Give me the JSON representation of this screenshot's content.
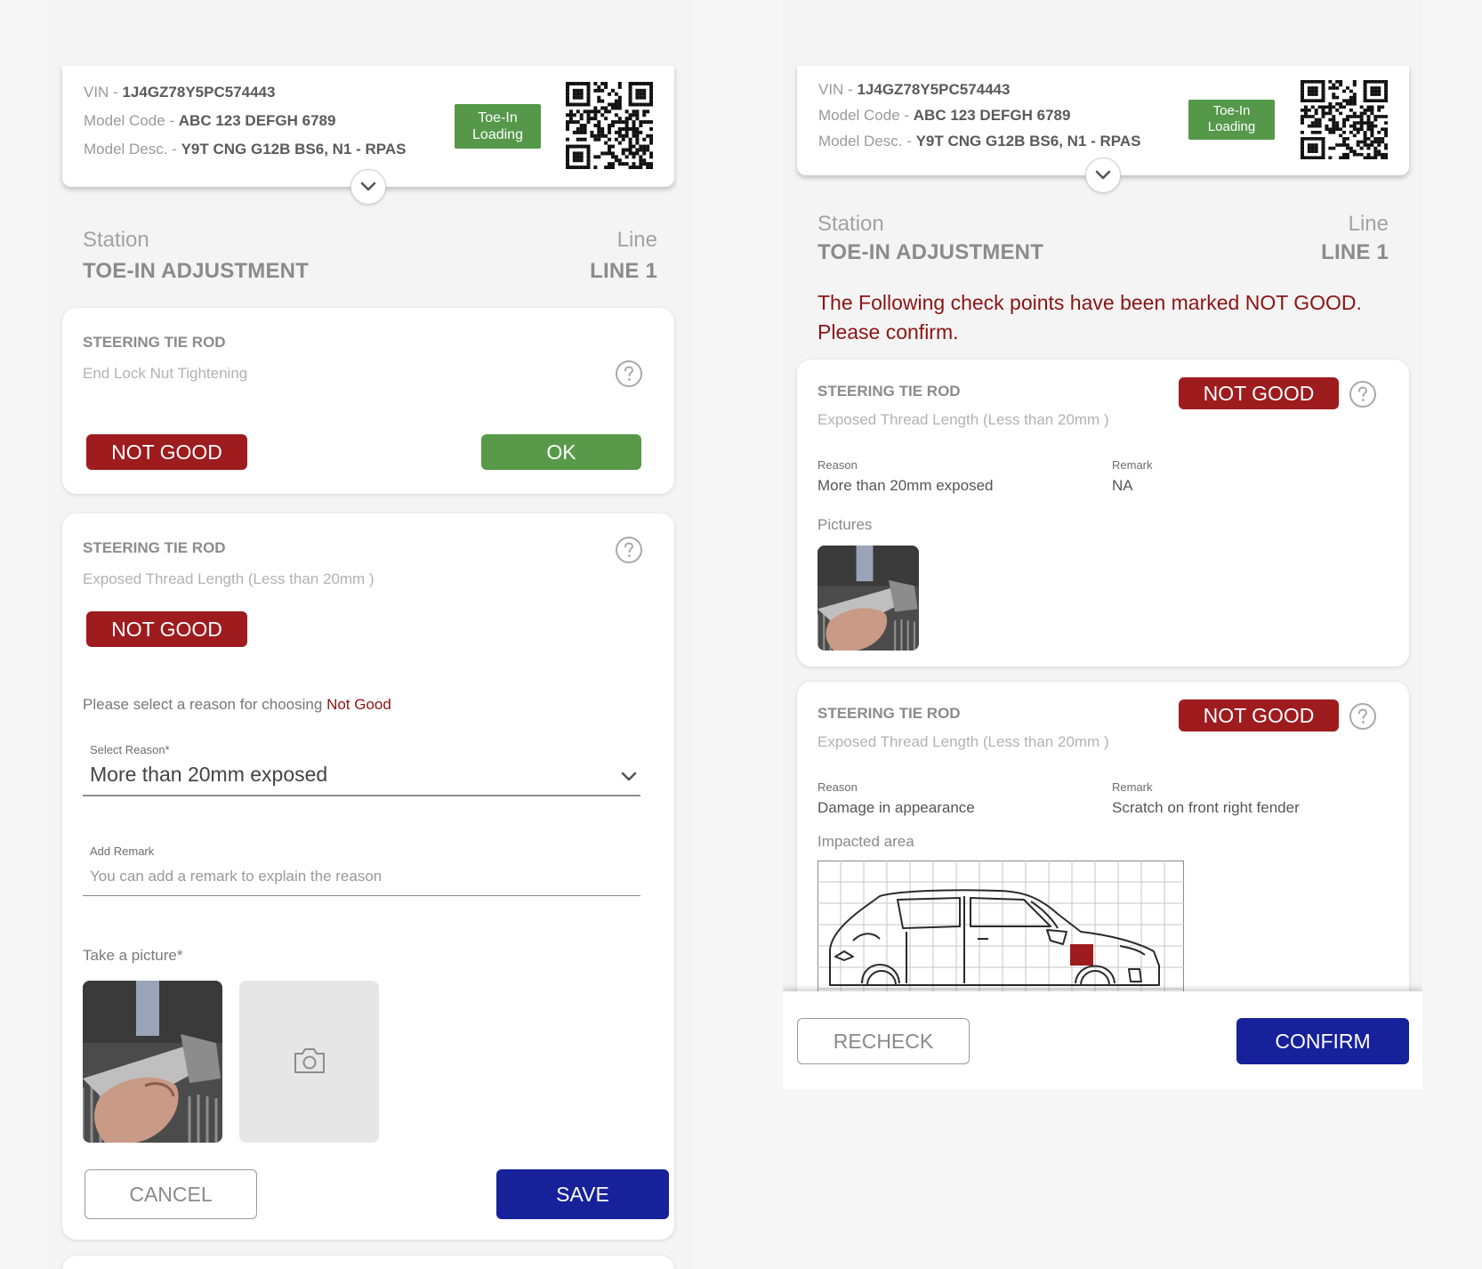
{
  "vehicle": {
    "vin_label": "VIN - ",
    "vin": "1J4GZ78Y5PC574443",
    "model_code_label": "Model Code - ",
    "model_code": "ABC 123 DEFGH 6789",
    "model_desc_label": "Model Desc. - ",
    "model_desc": "Y9T CNG G12B BS6, N1 - RPAS",
    "badge_line1": "Toe-In",
    "badge_line2": "Loading"
  },
  "station": {
    "station_label": "Station",
    "station_value": "TOE-IN ADJUSTMENT",
    "line_label": "Line",
    "line_value": "LINE 1"
  },
  "left": {
    "check1": {
      "title": "STEERING TIE ROD",
      "desc": "End Lock Nut Tightening",
      "not_good_label": "NOT GOOD",
      "ok_label": "OK"
    },
    "check2": {
      "title": "STEERING TIE ROD",
      "desc": "Exposed Thread Length (Less than 20mm )",
      "not_good_label": "NOT GOOD",
      "reason_prompt": "Please select a reason for choosing ",
      "reason_prompt_emph": "Not Good",
      "select_label": "Select Reason*",
      "select_value": "More than 20mm exposed",
      "remark_label": "Add Remark",
      "remark_placeholder": "You can add a remark to explain the reason",
      "picture_label": "Take a picture*",
      "cancel_label": "CANCEL",
      "save_label": "SAVE"
    }
  },
  "right": {
    "warning_line1": "The Following check points have been marked NOT GOOD.",
    "warning_line2": "Please confirm.",
    "items": [
      {
        "title": "STEERING TIE ROD",
        "desc": "Exposed Thread Length (Less than 20mm )",
        "status": "NOT GOOD",
        "reason_label": "Reason",
        "reason": "More than 20mm exposed",
        "remark_label": "Remark",
        "remark": "NA",
        "media_label": "Pictures"
      },
      {
        "title": "STEERING TIE ROD",
        "desc": "Exposed Thread Length (Less than 20mm )",
        "status": "NOT GOOD",
        "reason_label": "Reason",
        "reason": "Damage in appearance",
        "remark_label": "Remark",
        "remark": "Scratch on front right fender",
        "media_label": "Impacted area"
      }
    ],
    "recheck_label": "RECHECK",
    "confirm_label": "CONFIRM"
  },
  "colors": {
    "not_good": "#9e1b1e",
    "ok": "#589a4a",
    "primary": "#16219a",
    "badge": "#55984a",
    "warning_text": "#8c1313"
  },
  "icons": [
    "chevron-down-icon",
    "help-icon",
    "camera-icon",
    "qr-code-icon"
  ]
}
